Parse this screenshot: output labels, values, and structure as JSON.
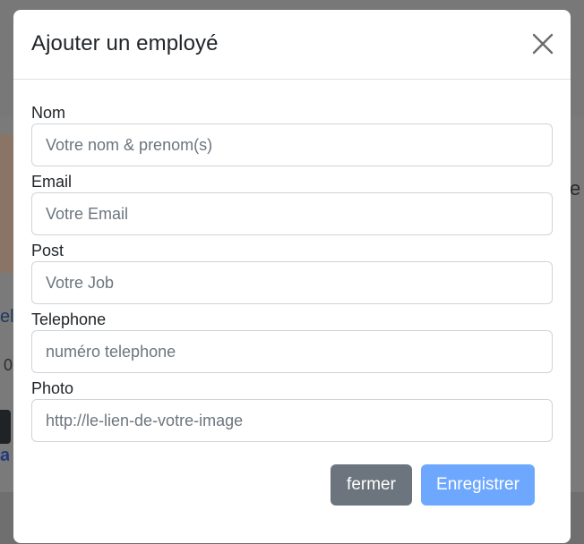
{
  "modal": {
    "title": "Ajouter un employé",
    "close_icon": "close-icon"
  },
  "form": {
    "fields": [
      {
        "label": "Nom",
        "placeholder": "Votre nom & prenom(s)"
      },
      {
        "label": "Email",
        "placeholder": "Votre Email"
      },
      {
        "label": "Post",
        "placeholder": "Votre Job"
      },
      {
        "label": "Telephone",
        "placeholder": "numéro telephone"
      },
      {
        "label": "Photo",
        "placeholder": "http://le-lien-de-votre-image"
      }
    ]
  },
  "footer": {
    "close_label": "fermer",
    "save_label": "Enregistrer"
  },
  "background": {
    "link_fragment": "el@",
    "number_fragment": "0",
    "right_fragment": "e",
    "blue_fragment": "a"
  },
  "colors": {
    "secondary": "#6c757d",
    "primary_disabled": "#6ea8fe",
    "border": "#ced4da"
  }
}
